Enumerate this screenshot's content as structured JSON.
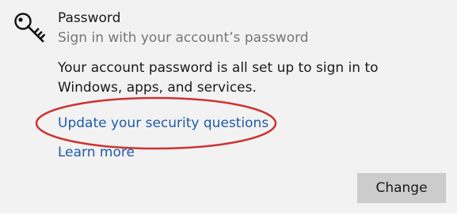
{
  "password_section": {
    "icon": "key-icon",
    "title": "Password",
    "subtitle": "Sign in with your account’s password",
    "description": "Your account password is all set up to sign in to Windows, apps, and services.",
    "links": {
      "security_questions": "Update your security questions",
      "learn_more": "Learn more"
    },
    "change_button_label": "Change"
  },
  "colors": {
    "panel_background": "#f2f2f2",
    "link": "#1e5aa8",
    "secondary_text": "#767676",
    "button_background": "#cccccc",
    "annotation_ellipse": "#cc3333"
  }
}
